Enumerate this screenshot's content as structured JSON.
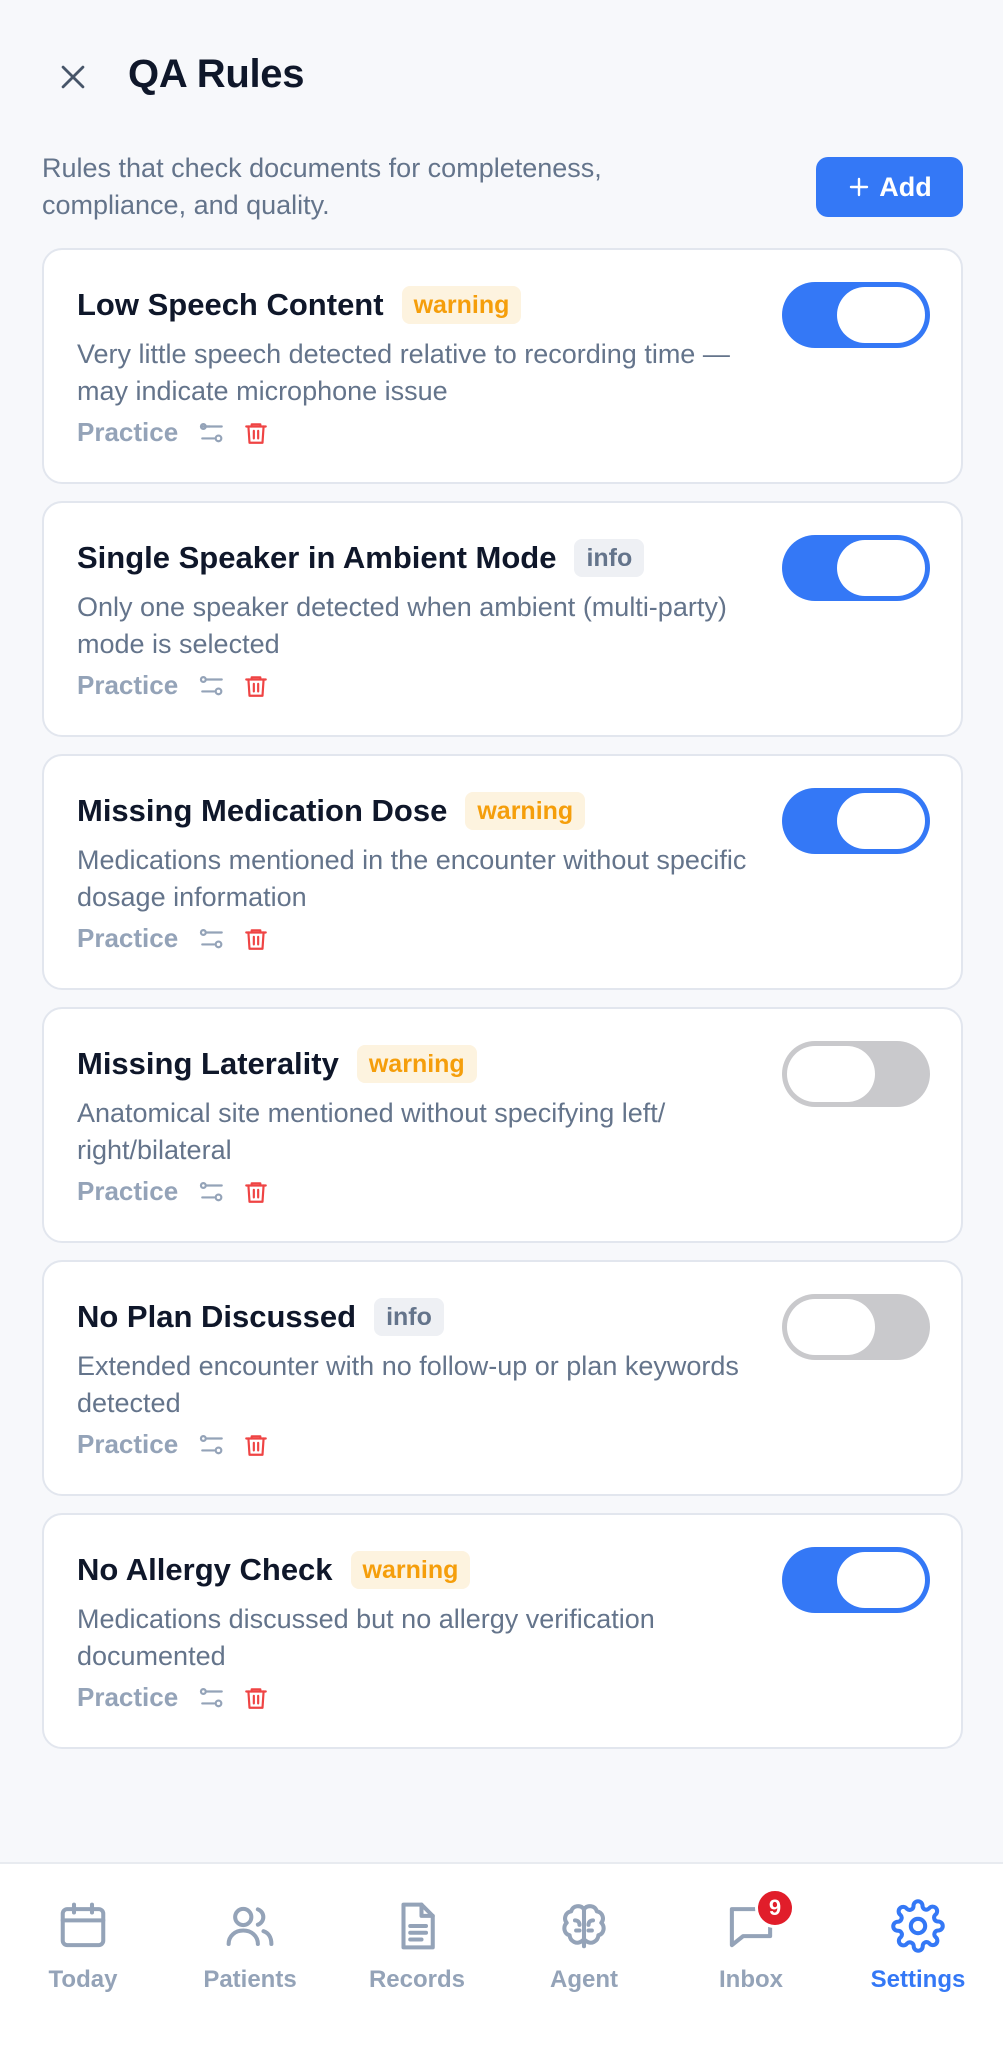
{
  "header": {
    "title": "QA Rules"
  },
  "intro": "Rules that check documents for completeness, compliance, and quality.",
  "add_button": {
    "label": "Add"
  },
  "rules": [
    {
      "title": "Low Speech Content",
      "severity": "warning",
      "description": "Very little speech detected relative to recording time — may indicate microphone issue",
      "scope": "Practice",
      "enabled": true
    },
    {
      "title": "Single Speaker in Ambient Mode",
      "severity": "info",
      "description": "Only one speaker detected when ambient (multi-party) mode is selected",
      "scope": "Practice",
      "enabled": true
    },
    {
      "title": "Missing Medication Dose",
      "severity": "warning",
      "description": "Medications mentioned in the encounter without specific dosage information",
      "scope": "Practice",
      "enabled": true
    },
    {
      "title": "Missing Laterality",
      "severity": "warning",
      "description": "Anatomical site mentioned without specifying left/ right/bilateral",
      "scope": "Practice",
      "enabled": false
    },
    {
      "title": "No Plan Discussed",
      "severity": "info",
      "description": "Extended encounter with no follow-up or plan keywords detected",
      "scope": "Practice",
      "enabled": false
    },
    {
      "title": "No Allergy Check",
      "severity": "warning",
      "description": "Medications discussed but no allergy verification documented",
      "scope": "Practice",
      "enabled": true
    }
  ],
  "tabs": [
    {
      "label": "Today",
      "icon": "calendar-icon"
    },
    {
      "label": "Patients",
      "icon": "users-icon"
    },
    {
      "label": "Records",
      "icon": "document-icon"
    },
    {
      "label": "Agent",
      "icon": "brain-icon"
    },
    {
      "label": "Inbox",
      "icon": "message-icon",
      "badge": "9"
    },
    {
      "label": "Settings",
      "icon": "gear-icon",
      "active": true
    }
  ],
  "colors": {
    "accent": "#3478f6",
    "warning": "#f59e0b",
    "danger": "#ef4444",
    "badge_red": "#e11d2a"
  }
}
